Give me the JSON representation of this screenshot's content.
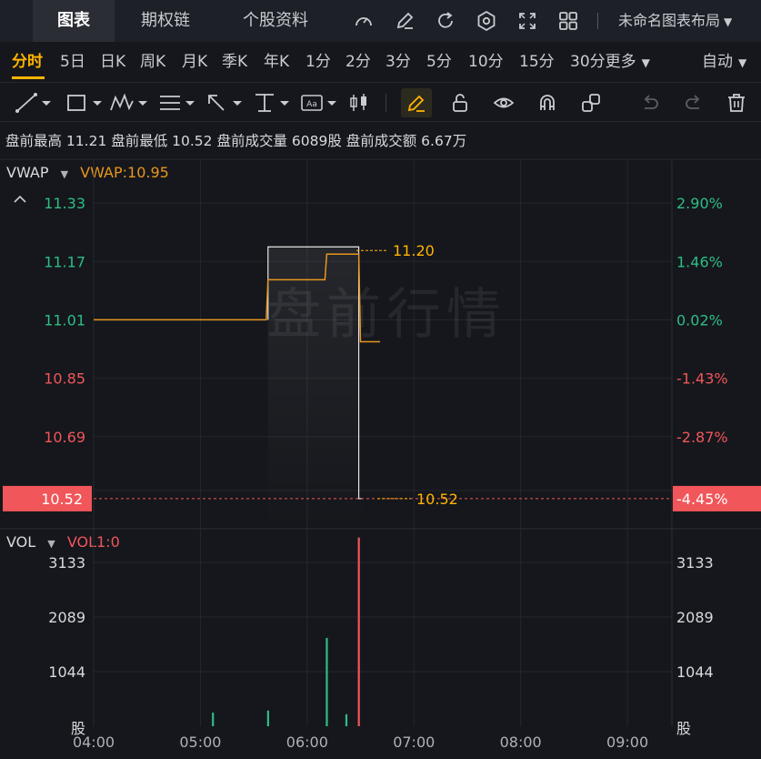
{
  "top_tabs": [
    "图表",
    "期权链",
    "个股资料"
  ],
  "layout_name": "未命名图表布局",
  "periods": [
    "分时",
    "5日",
    "日K",
    "周K",
    "月K",
    "季K",
    "年K",
    "1分",
    "2分",
    "3分",
    "5分",
    "10分",
    "15分",
    "30分更多"
  ],
  "auto_label": "自动",
  "premarket_info": "盘前最高 11.21  盘前最低 10.52  盘前成交量 6089股  盘前成交额 6.67万",
  "indicator_price": {
    "name": "VWAP",
    "value_label": "VWAP:10.95"
  },
  "indicator_volume": {
    "name": "VOL",
    "value_label": "VOL1:0"
  },
  "watermark": "盘前行情",
  "colors": {
    "up": "#2ebd85",
    "down": "#f0565a",
    "accent": "#ffb400",
    "vwap": "#e8961e",
    "price_line": "#e6e6e6"
  },
  "chart_data": {
    "type": "line",
    "price_axis": {
      "left_ticks": [
        "11.33",
        "11.17",
        "11.01",
        "10.85",
        "10.69"
      ],
      "right_ticks": [
        "2.90%",
        "1.46%",
        "0.02%",
        "-1.43%",
        "-2.87%"
      ],
      "tick_values": [
        11.33,
        11.17,
        11.01,
        10.85,
        10.69
      ],
      "last_price_label": "10.52",
      "last_pct_label": "-4.45%",
      "ylim": [
        10.44,
        11.45
      ]
    },
    "price_series": {
      "x": [
        "05:38",
        "05:38",
        "06:29",
        "06:29",
        "06:31"
      ],
      "values": [
        11.01,
        11.21,
        11.21,
        10.52,
        10.52
      ]
    },
    "vwap_series": {
      "x": [
        "04:00",
        "05:37",
        "05:38",
        "06:10",
        "06:11",
        "06:29",
        "06:30",
        "06:41"
      ],
      "values": [
        11.01,
        11.01,
        11.12,
        11.12,
        11.19,
        11.19,
        10.95,
        10.95
      ]
    },
    "annotations": [
      {
        "label": "11.20",
        "value": 11.2
      },
      {
        "label": "10.52",
        "value": 10.52
      }
    ],
    "volume_axis": {
      "ticks": [
        "3133",
        "2089",
        "1044"
      ],
      "tick_values": [
        3133,
        2089,
        1044
      ],
      "unit_label": "股",
      "ylim": [
        0,
        3760
      ]
    },
    "volume_bars": [
      {
        "x": "05:07",
        "value": 260,
        "color": "up"
      },
      {
        "x": "05:38",
        "value": 300,
        "color": "up"
      },
      {
        "x": "06:11",
        "value": 1690,
        "color": "up"
      },
      {
        "x": "06:22",
        "value": 230,
        "color": "up"
      },
      {
        "x": "06:29",
        "value": 3610,
        "color": "down"
      }
    ],
    "x_ticks": [
      "04:00",
      "05:00",
      "06:00",
      "07:00",
      "08:00",
      "09:00"
    ],
    "x_range": [
      "04:00",
      "09:25"
    ]
  }
}
